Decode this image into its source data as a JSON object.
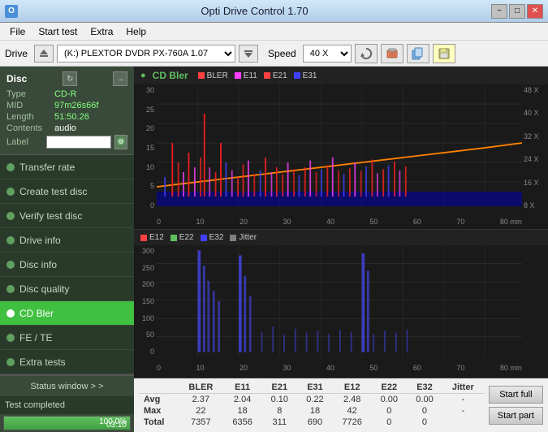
{
  "titlebar": {
    "title": "Opti Drive Control 1.70",
    "icon": "O",
    "minimize": "−",
    "maximize": "□",
    "close": "✕"
  },
  "menubar": {
    "items": [
      "File",
      "Start test",
      "Extra",
      "Help"
    ]
  },
  "drivebar": {
    "drive_label": "Drive",
    "drive_value": "(K:)  PLEXTOR DVDR  PX-760A 1.07",
    "speed_label": "Speed",
    "speed_value": "40 X"
  },
  "sidebar": {
    "disc_title": "Disc",
    "disc_info": {
      "type_label": "Type",
      "type_value": "CD-R",
      "mid_label": "MID",
      "mid_value": "97m26s66f",
      "length_label": "Length",
      "length_value": "51:50.26",
      "contents_label": "Contents",
      "contents_value": "audio",
      "label_label": "Label"
    },
    "nav_items": [
      {
        "id": "transfer-rate",
        "label": "Transfer rate",
        "active": false
      },
      {
        "id": "create-test-disc",
        "label": "Create test disc",
        "active": false
      },
      {
        "id": "verify-test-disc",
        "label": "Verify test disc",
        "active": false
      },
      {
        "id": "drive-info",
        "label": "Drive info",
        "active": false
      },
      {
        "id": "disc-info",
        "label": "Disc info",
        "active": false
      },
      {
        "id": "disc-quality",
        "label": "Disc quality",
        "active": false
      },
      {
        "id": "cd-bler",
        "label": "CD Bler",
        "active": true
      },
      {
        "id": "fe-te",
        "label": "FE / TE",
        "active": false
      },
      {
        "id": "extra-tests",
        "label": "Extra tests",
        "active": false
      }
    ],
    "status_window": "Status window > >",
    "test_completed": "Test completed",
    "progress_percent": "100.0%",
    "time_display": "03:10"
  },
  "chart1": {
    "title": "CD Bler",
    "legend": [
      {
        "label": "BLER",
        "color": "#ff4040"
      },
      {
        "label": "E11",
        "color": "#ff40ff"
      },
      {
        "label": "E21",
        "color": "#ff4040"
      },
      {
        "label": "E31",
        "color": "#4040ff"
      }
    ],
    "y_labels": [
      "0",
      "5",
      "10",
      "15",
      "20",
      "25",
      "30"
    ],
    "y_labels_right": [
      "8 X",
      "16 X",
      "24 X",
      "32 X",
      "40 X",
      "48 X"
    ],
    "x_labels": [
      "0",
      "10",
      "20",
      "30",
      "40",
      "50",
      "60",
      "70",
      "80 min"
    ]
  },
  "chart2": {
    "legend": [
      {
        "label": "E12",
        "color": "#ff4040"
      },
      {
        "label": "E22",
        "color": "#60c060"
      },
      {
        "label": "E32",
        "color": "#4040ff"
      },
      {
        "label": "Jitter",
        "color": "#808080"
      }
    ],
    "y_labels": [
      "0",
      "50",
      "100",
      "150",
      "200",
      "250",
      "300"
    ],
    "x_labels": [
      "0",
      "10",
      "20",
      "30",
      "40",
      "50",
      "60",
      "70",
      "80 min"
    ]
  },
  "data_table": {
    "headers": [
      "",
      "BLER",
      "E11",
      "E21",
      "E31",
      "E12",
      "E22",
      "E32",
      "Jitter"
    ],
    "rows": [
      {
        "label": "Avg",
        "values": [
          "2.37",
          "2.04",
          "0.10",
          "0.22",
          "2.48",
          "0.00",
          "0.00",
          "-"
        ]
      },
      {
        "label": "Max",
        "values": [
          "22",
          "18",
          "8",
          "18",
          "42",
          "0",
          "0",
          "-"
        ]
      },
      {
        "label": "Total",
        "values": [
          "7357",
          "6356",
          "311",
          "690",
          "7726",
          "0",
          "0",
          ""
        ]
      }
    ],
    "start_full": "Start full",
    "start_part": "Start part"
  }
}
